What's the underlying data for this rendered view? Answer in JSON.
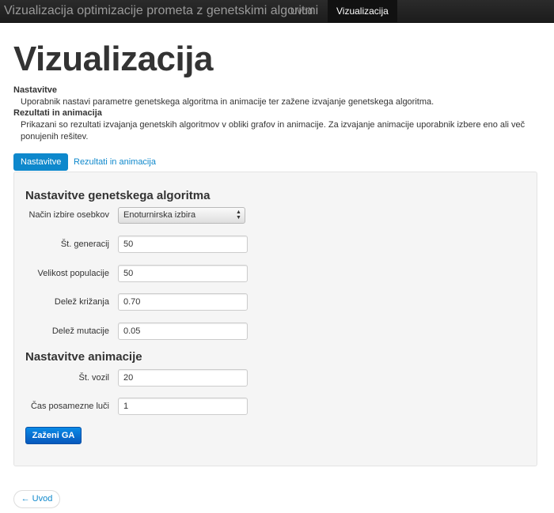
{
  "navbar": {
    "brand": "Vizualizacija optimizacije prometa z genetskimi algoritmi",
    "items": [
      {
        "label": "Uvod",
        "active": false
      },
      {
        "label": "Vizualizacija",
        "active": true
      }
    ]
  },
  "header": {
    "title": "Vizualizacija",
    "sections": [
      {
        "heading": "Nastavitve",
        "text": "Uporabnik nastavi parametre genetskega algoritma in animacije ter zažene izvajanje genetskega algoritma."
      },
      {
        "heading": "Rezultati in animacija",
        "text": "Prikazani so rezultati izvajanja genetskih algoritmov v obliki grafov in animacije. Za izvajanje animacije uporabnik izbere eno ali več ponujenih rešitev."
      }
    ]
  },
  "tabs": [
    {
      "label": "Nastavitve",
      "active": true
    },
    {
      "label": "Rezultati in animacija",
      "active": false
    }
  ],
  "ga_settings": {
    "title": "Nastavitve genetskega algoritma",
    "selection": {
      "label": "Način izbire osebkov",
      "value": "Enoturnirska izbira"
    },
    "generations": {
      "label": "Št. generacij",
      "value": "50"
    },
    "population": {
      "label": "Velikost populacije",
      "value": "50"
    },
    "crossover": {
      "label": "Delež križanja",
      "value": "0.70"
    },
    "mutation": {
      "label": "Delež mutacije",
      "value": "0.05"
    }
  },
  "animation_settings": {
    "title": "Nastavitve animacije",
    "vehicles": {
      "label": "Št. vozil",
      "value": "20"
    },
    "light_time": {
      "label": "Čas posamezne luči",
      "value": "1"
    }
  },
  "buttons": {
    "run": "Zaženi GA",
    "back": "← Uvod"
  },
  "colors": {
    "accent": "#0e88cc",
    "primary_button": "#0758bd",
    "navbar": "#222222"
  }
}
